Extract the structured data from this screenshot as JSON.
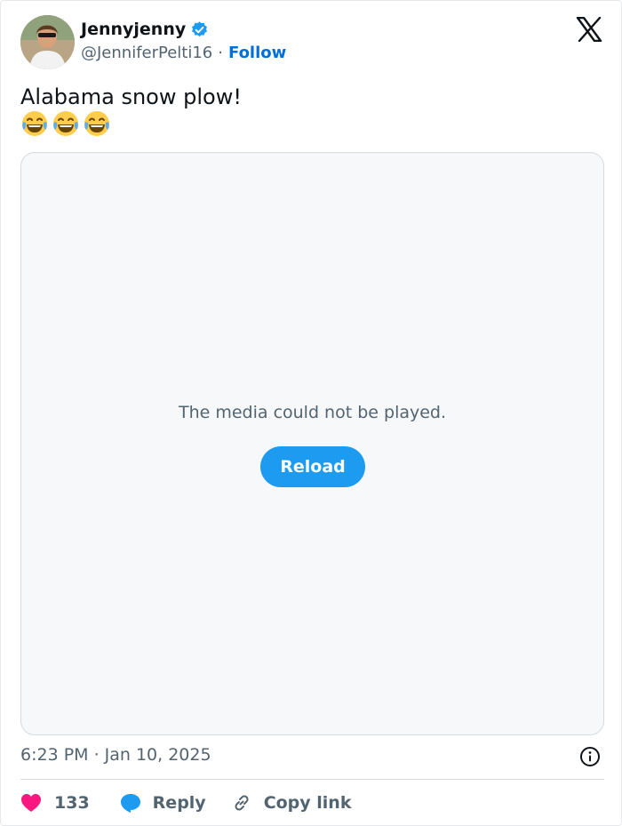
{
  "author": {
    "display_name": "Jennyjenny",
    "handle": "@JenniferPelti16",
    "separator": "·",
    "follow_label": "Follow"
  },
  "tweet": {
    "text": "Alabama snow plow!",
    "emojis": [
      "😂",
      "😂",
      "😂"
    ]
  },
  "media": {
    "error_message": "The media could not be played.",
    "reload_label": "Reload"
  },
  "meta": {
    "time": "6:23 PM",
    "separator": "·",
    "date": "Jan 10, 2025"
  },
  "actions": {
    "like_count": "133",
    "reply_label": "Reply",
    "copy_label": "Copy link"
  },
  "icons": {
    "brand": "x-logo-icon",
    "verified": "verified-badge-icon",
    "like": "heart-icon",
    "reply": "reply-bubble-icon",
    "copy": "link-icon",
    "info": "info-icon"
  },
  "colors": {
    "accent": "#1d9bf0",
    "follow_link": "#006fd6",
    "like": "#f91880",
    "secondary_text": "#536471"
  }
}
